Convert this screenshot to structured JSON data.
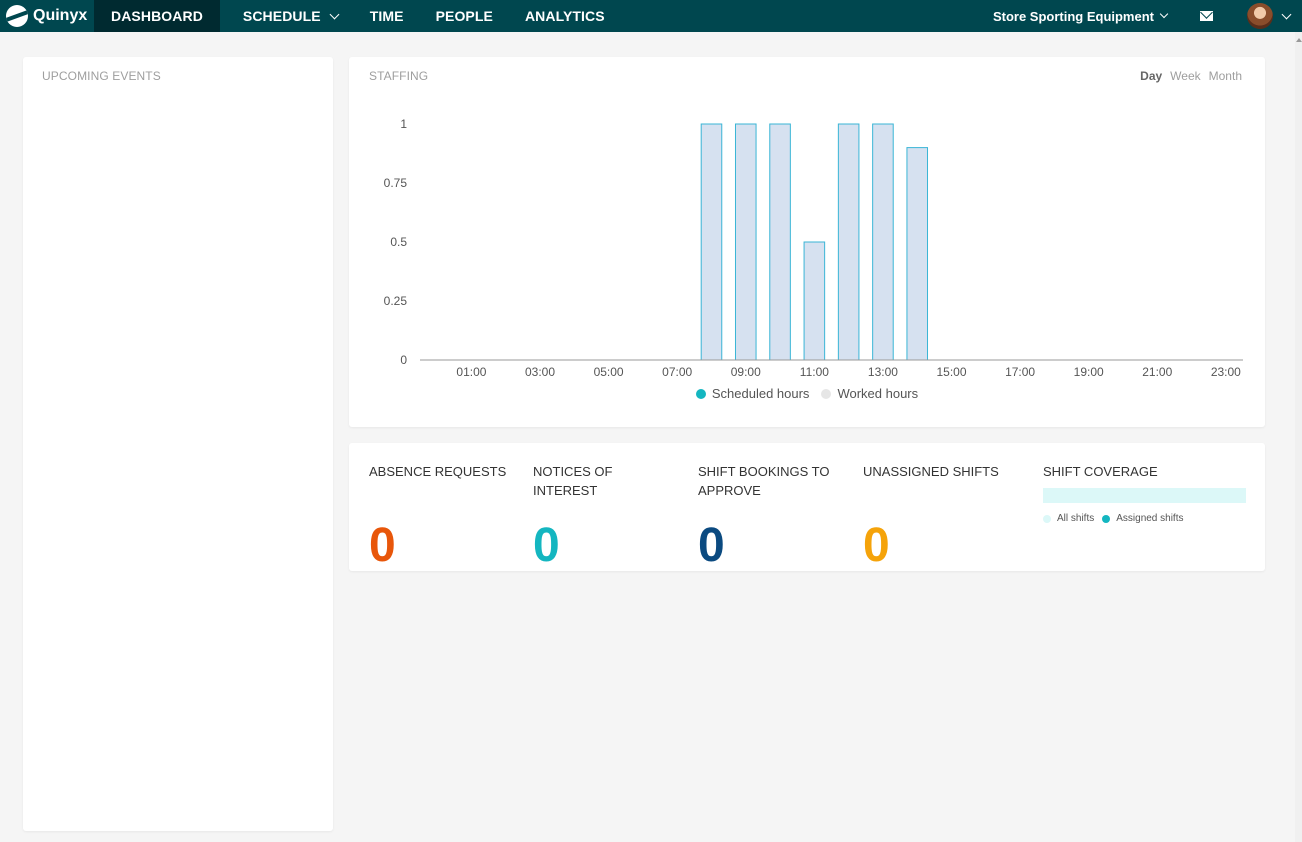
{
  "nav": {
    "brand": "Quinyx",
    "items": [
      {
        "label": "DASHBOARD",
        "active": true,
        "dropdown": false
      },
      {
        "label": "SCHEDULE",
        "active": false,
        "dropdown": true
      },
      {
        "label": "TIME",
        "active": false,
        "dropdown": false
      },
      {
        "label": "PEOPLE",
        "active": false,
        "dropdown": false
      },
      {
        "label": "ANALYTICS",
        "active": false,
        "dropdown": false
      }
    ],
    "store": "Store Sporting Equipment",
    "icons": [
      "mail-icon",
      "avatar",
      "chevron-down-icon"
    ]
  },
  "events": {
    "title": "UPCOMING EVENTS"
  },
  "staffing": {
    "title": "STAFFING",
    "ranges": [
      "Day",
      "Week",
      "Month"
    ],
    "selected_range": "Day"
  },
  "chart_data": {
    "type": "bar",
    "x": [
      "00:00",
      "01:00",
      "02:00",
      "03:00",
      "04:00",
      "05:00",
      "06:00",
      "07:00",
      "08:00",
      "09:00",
      "10:00",
      "11:00",
      "12:00",
      "13:00",
      "14:00",
      "15:00",
      "16:00",
      "17:00",
      "18:00",
      "19:00",
      "20:00",
      "21:00",
      "22:00",
      "23:00"
    ],
    "xtick_labels": [
      "01:00",
      "03:00",
      "05:00",
      "07:00",
      "09:00",
      "11:00",
      "13:00",
      "15:00",
      "17:00",
      "19:00",
      "21:00",
      "23:00"
    ],
    "series": [
      {
        "name": "Scheduled hours",
        "values": [
          0,
          0,
          0,
          0,
          0,
          0,
          0,
          0,
          1,
          1,
          1,
          0.5,
          1,
          1,
          0.9,
          0,
          0,
          0,
          0,
          0,
          0,
          0,
          0,
          0
        ],
        "color": "#d6e1f0",
        "stroke": "#3ab5d6"
      },
      {
        "name": "Worked hours",
        "values": [],
        "color": "#e6e6e6"
      }
    ],
    "ylim": [
      0,
      1
    ],
    "yticks": [
      "0",
      "0.25",
      "0.5",
      "0.75",
      "1"
    ],
    "legend_position": "bottom",
    "legend_dot_colors": [
      "#14b6c0",
      "#e6e6e6"
    ]
  },
  "stats": [
    {
      "label": "ABSENCE REQUESTS",
      "value": "0",
      "color": "#e8560a"
    },
    {
      "label": "NOTICES OF INTEREST",
      "value": "0",
      "color": "#14b6c0"
    },
    {
      "label": "SHIFT BOOKINGS TO APPROVE",
      "value": "0",
      "color": "#0b4a80"
    },
    {
      "label": "UNASSIGNED SHIFTS",
      "value": "0",
      "color": "#f5a30a"
    }
  ],
  "coverage": {
    "title": "SHIFT COVERAGE",
    "legend": [
      {
        "label": "All shifts",
        "color": "#dcf8f8"
      },
      {
        "label": "Assigned shifts",
        "color": "#14b6c0"
      }
    ]
  }
}
